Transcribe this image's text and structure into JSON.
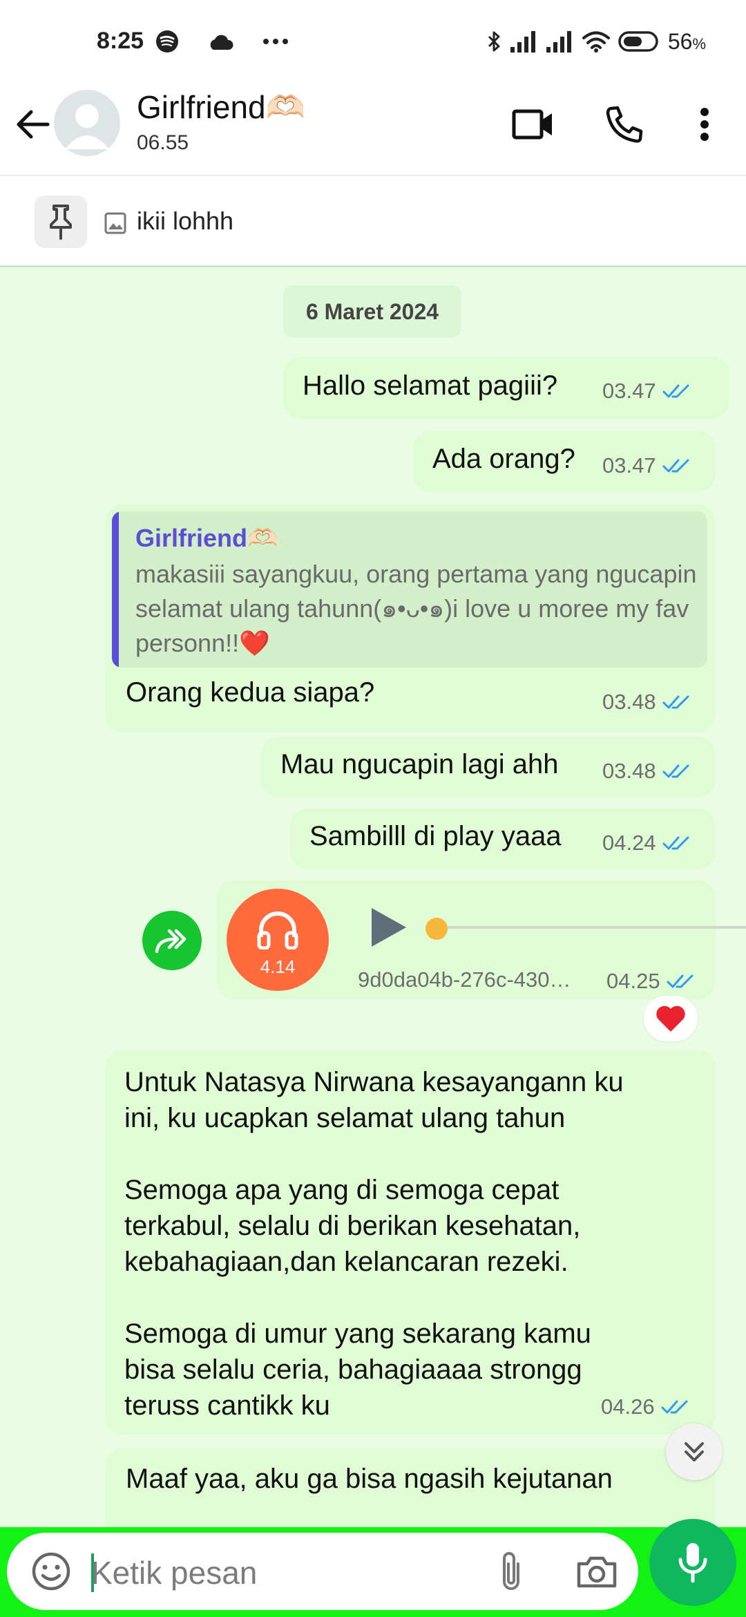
{
  "status_bar": {
    "time": "8:25",
    "battery": "56",
    "battery_unit": "%",
    "icons_left": [
      "spotify-icon",
      "cloud-icon",
      "more-dots-icon"
    ],
    "icons_right": [
      "bluetooth-icon",
      "signal-icon",
      "signal-icon",
      "wifi-icon",
      "battery-icon"
    ]
  },
  "header": {
    "contact_name": "Girlfriend🫶🏻",
    "last_seen": "06.55",
    "icons": [
      "back-arrow-icon",
      "avatar",
      "video-call-icon",
      "phone-icon",
      "more-vertical-icon"
    ]
  },
  "pinned": {
    "text": "ikii lohhh",
    "icons": [
      "pin-icon",
      "image-icon"
    ]
  },
  "chat": {
    "date_chip": "6 Maret 2024",
    "messages": [
      {
        "text": "Hallo selamat pagiii?",
        "time": "03.47"
      },
      {
        "text": "Ada orang?",
        "time": "03.47"
      },
      {
        "quoted_name": "Girlfriend🫶🏻",
        "quoted_text": "makasiii sayangkuu, orang pertama yang ngucapin selamat ulang tahunn(๑•ᴗ•๑)i love u moree my fav personn!!❤️",
        "text": "Orang kedua siapa?",
        "time": "03.48"
      },
      {
        "text": "Mau ngucapin lagi ahh",
        "time": "03.48"
      },
      {
        "text": "Sambilll di play yaaa",
        "time": "04.24"
      },
      {
        "audio_duration": "4.14",
        "file_name": "9d0da04b-276c-430…",
        "time": "04.25",
        "progress": 0,
        "reaction": "❤️"
      },
      {
        "text": "Untuk Natasya Nirwana kesayangann ku\nini, ku ucapkan selamat ulang tahun\n\nSemoga apa yang di semoga cepat\nterkabul, selalu di berikan kesehatan,\nkebahagiaan,dan kelancaran rezeki.\n\nSemoga di umur yang sekarang kamu\nbisa selalu ceria, bahagiaaaa strongg\nteruss cantikk ku",
        "time": "04.26"
      },
      {
        "text": "Maaf yaa, aku ga bisa ngasih kejutanan"
      }
    ]
  },
  "input": {
    "placeholder": "Ketik pesan",
    "icons": [
      "emoji-icon",
      "attach-icon",
      "camera-icon",
      "mic-icon"
    ]
  },
  "colors": {
    "chat_background": "#e8fde3",
    "bubble": "#dffcd4",
    "read_ticks": "#2f9bea",
    "quote_accent": "#5b4ed6",
    "input_bar": "#13f313",
    "mic_button": "#0fb85f"
  }
}
